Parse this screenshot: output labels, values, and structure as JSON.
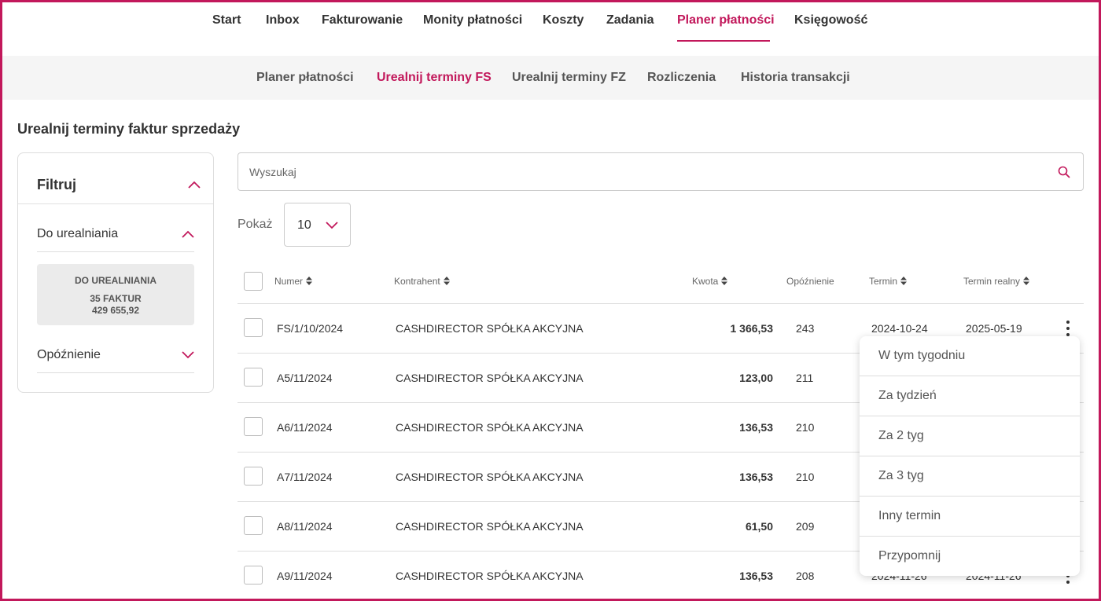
{
  "topnav": {
    "items": [
      "Start",
      "Inbox",
      "Fakturowanie",
      "Monity płatności",
      "Koszty",
      "Zadania",
      "Planer płatności",
      "Księgowość"
    ],
    "active": "Planer płatności"
  },
  "subnav": {
    "items": [
      "Planer płatności",
      "Urealnij terminy FS",
      "Urealnij terminy FZ",
      "Rozliczenia",
      "Historia transakcji"
    ],
    "active": "Urealnij terminy FS"
  },
  "page_title": "Urealnij terminy faktur sprzedaży",
  "filter": {
    "title": "Filtruj",
    "section_pending": "Do urealniania",
    "summary": {
      "heading": "DO UREALNIANIA",
      "count": "35 FAKTUR",
      "amount": "429 655,92"
    },
    "section_delay": "Opóźnienie"
  },
  "search": {
    "placeholder": "Wyszukaj"
  },
  "page_size": {
    "label": "Pokaż",
    "value": "10"
  },
  "table": {
    "headers": {
      "number": "Numer",
      "contractor": "Kontrahent",
      "amount": "Kwota",
      "delay": "Opóźnienie",
      "due": "Termin",
      "real_due": "Termin realny"
    },
    "rows": [
      {
        "number": "FS/1/10/2024",
        "contractor": "CASHDIRECTOR SPÓŁKA AKCYJNA",
        "amount": "1 366,53",
        "delay": "243",
        "due": "2024-10-24",
        "real_due": "2025-05-19"
      },
      {
        "number": "A5/11/2024",
        "contractor": "CASHDIRECTOR SPÓŁKA AKCYJNA",
        "amount": "123,00",
        "delay": "211",
        "due": "",
        "real_due": ""
      },
      {
        "number": "A6/11/2024",
        "contractor": "CASHDIRECTOR SPÓŁKA AKCYJNA",
        "amount": "136,53",
        "delay": "210",
        "due": "",
        "real_due": ""
      },
      {
        "number": "A7/11/2024",
        "contractor": "CASHDIRECTOR SPÓŁKA AKCYJNA",
        "amount": "136,53",
        "delay": "210",
        "due": "",
        "real_due": ""
      },
      {
        "number": "A8/11/2024",
        "contractor": "CASHDIRECTOR SPÓŁKA AKCYJNA",
        "amount": "61,50",
        "delay": "209",
        "due": "",
        "real_due": ""
      },
      {
        "number": "A9/11/2024",
        "contractor": "CASHDIRECTOR SPÓŁKA AKCYJNA",
        "amount": "136,53",
        "delay": "208",
        "due": "2024-11-26",
        "real_due": "2024-11-26"
      }
    ]
  },
  "menu": {
    "options": [
      "W tym tygodniu",
      "Za tydzień",
      "Za 2 tyg",
      "Za 3 tyg",
      "Inny termin",
      "Przypomnij"
    ]
  },
  "colors": {
    "accent": "#c2185b"
  }
}
